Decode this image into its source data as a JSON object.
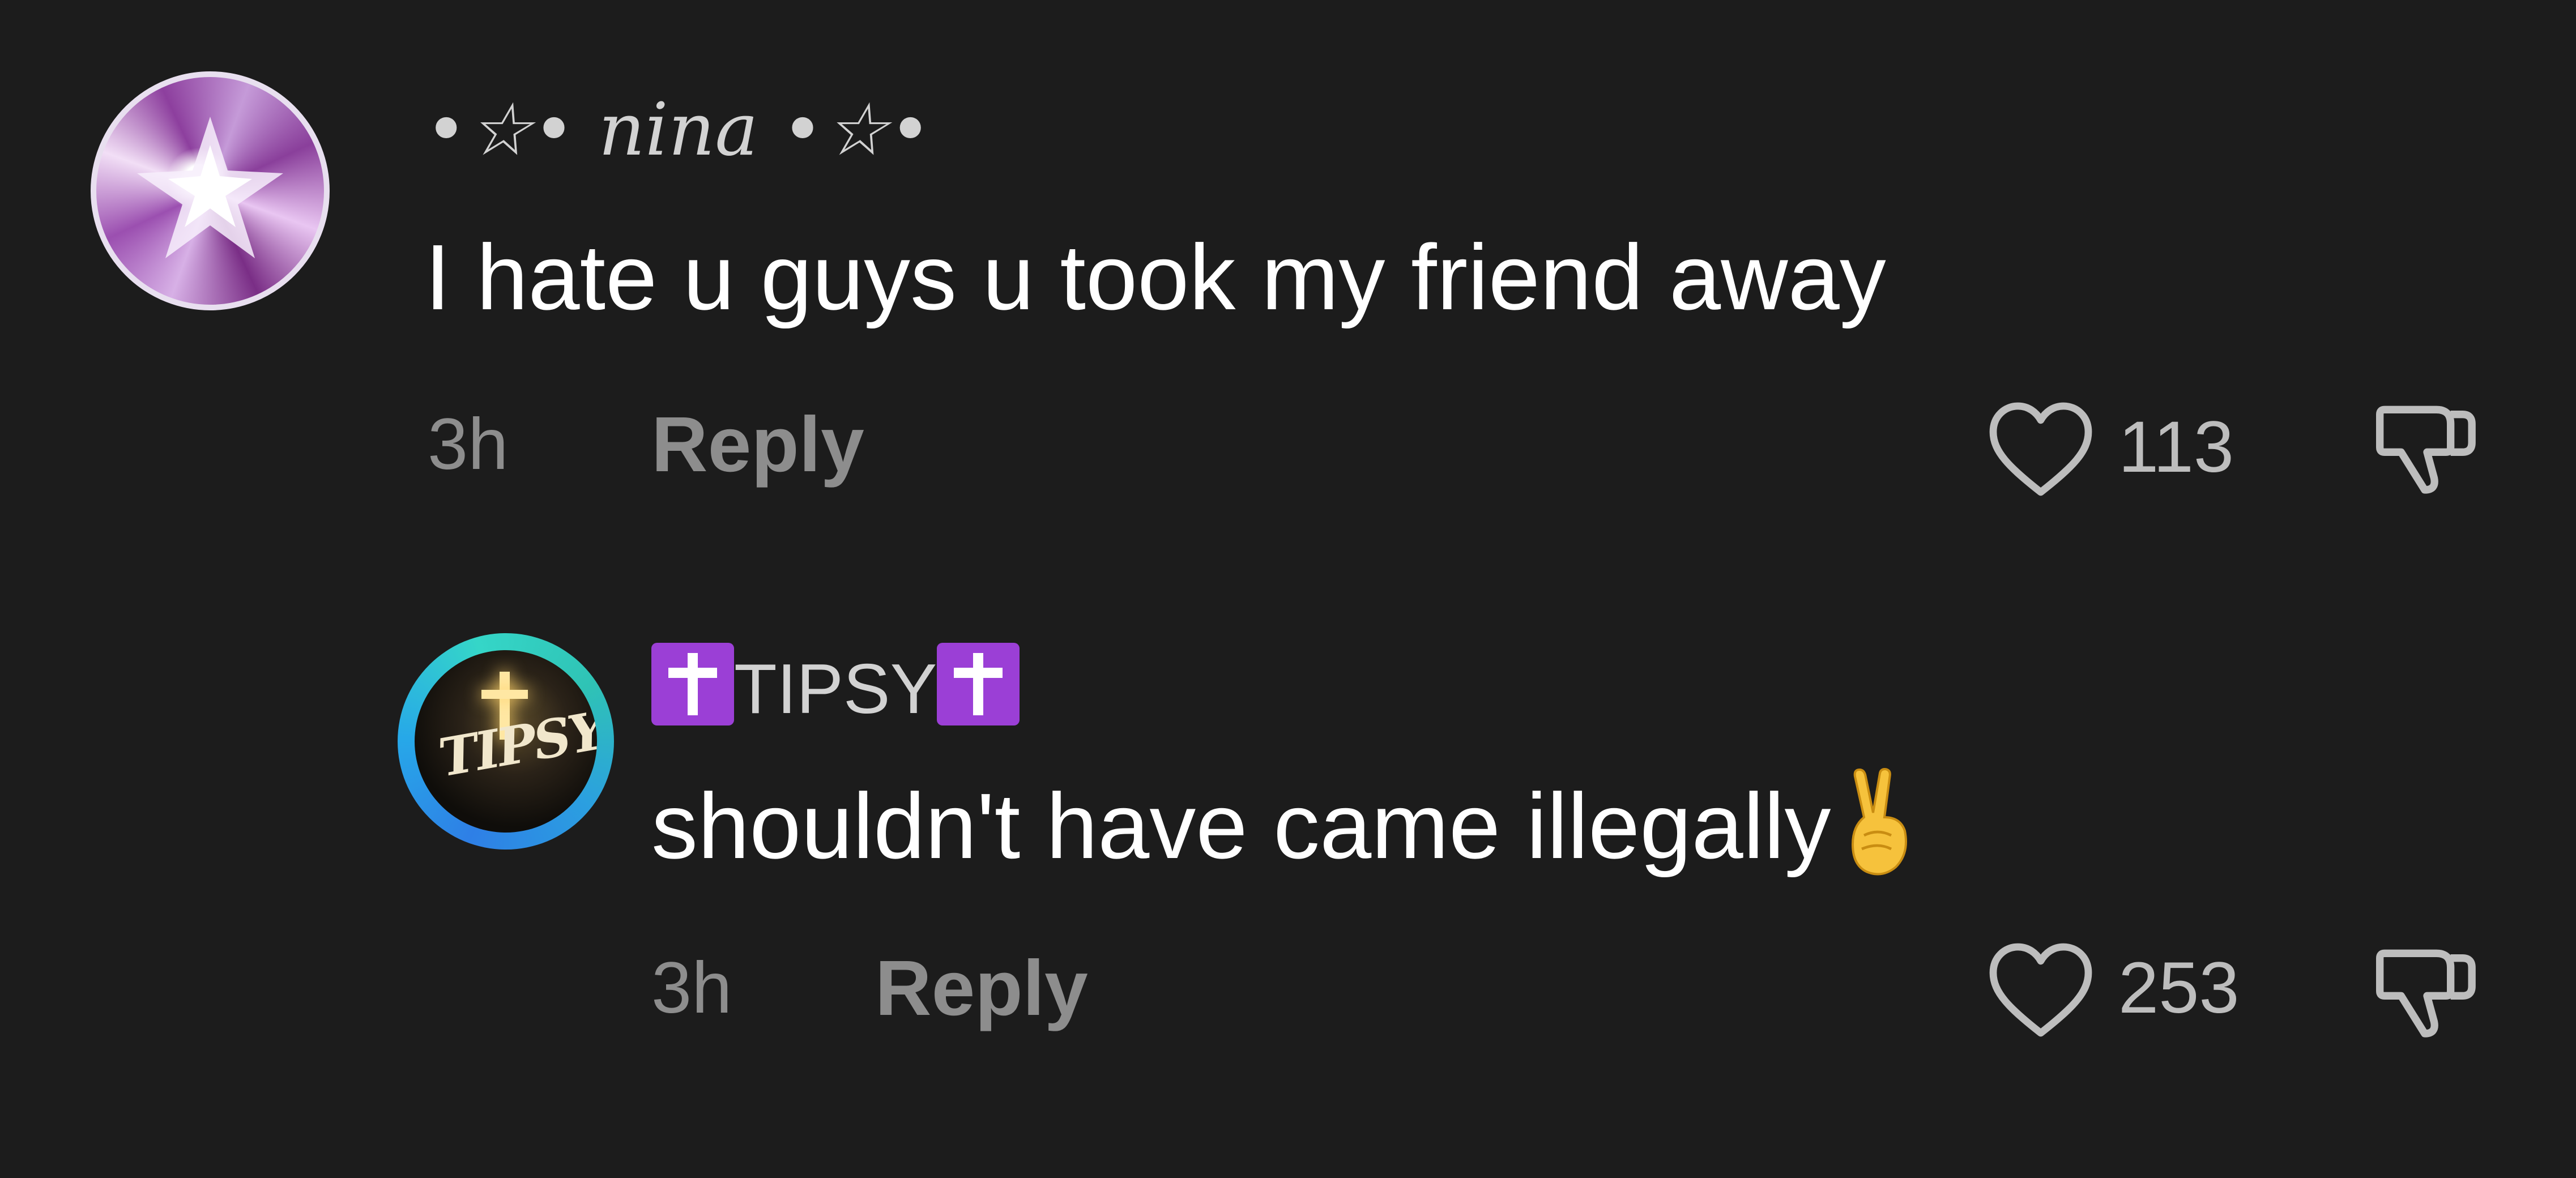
{
  "comments": [
    {
      "username": "•☆• nina •☆•",
      "text": "I hate u guys u took my friend away",
      "time": "3h",
      "reply_label": "Reply",
      "likes": "113",
      "avatar_icon": "nina-avatar-sparkle"
    },
    {
      "username": "TIPSY",
      "text": "shouldn't have came illegally",
      "emoji": "victory-hand-emoji",
      "time": "3h",
      "reply_label": "Reply",
      "likes": "253",
      "avatar_icon": "tipsy-avatar-logo",
      "avatar_logo_text": "TIPSY"
    }
  ],
  "colors": {
    "background": "#1c1c1c",
    "meta_text": "#8d8d8d",
    "username_text": "#d2d2d2",
    "badge_purple": "#9b3fd6",
    "ring_blue": "#27a8e8"
  }
}
